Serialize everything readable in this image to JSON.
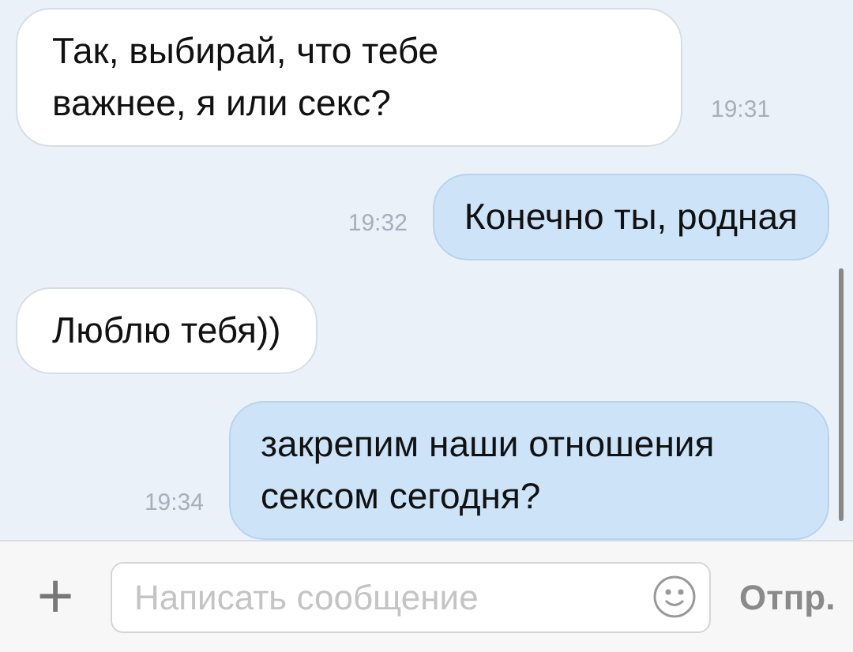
{
  "messages": [
    {
      "kind": "incoming",
      "lines": [
        "Так, выбирай, что тебе",
        "важнее, я или секс?"
      ],
      "time": "19:31"
    },
    {
      "kind": "outgoing",
      "lines": [
        "Конечно ты, родная"
      ],
      "time": "19:32"
    },
    {
      "kind": "incoming",
      "lines": [
        "Люблю тебя))"
      ]
    },
    {
      "kind": "outgoing",
      "lines": [
        "закрепим наши отношения",
        "сексом сегодня?"
      ],
      "time": "19:34"
    }
  ],
  "composer": {
    "add": "+",
    "placeholder": "Написать сообщение",
    "send": "Отпр."
  }
}
